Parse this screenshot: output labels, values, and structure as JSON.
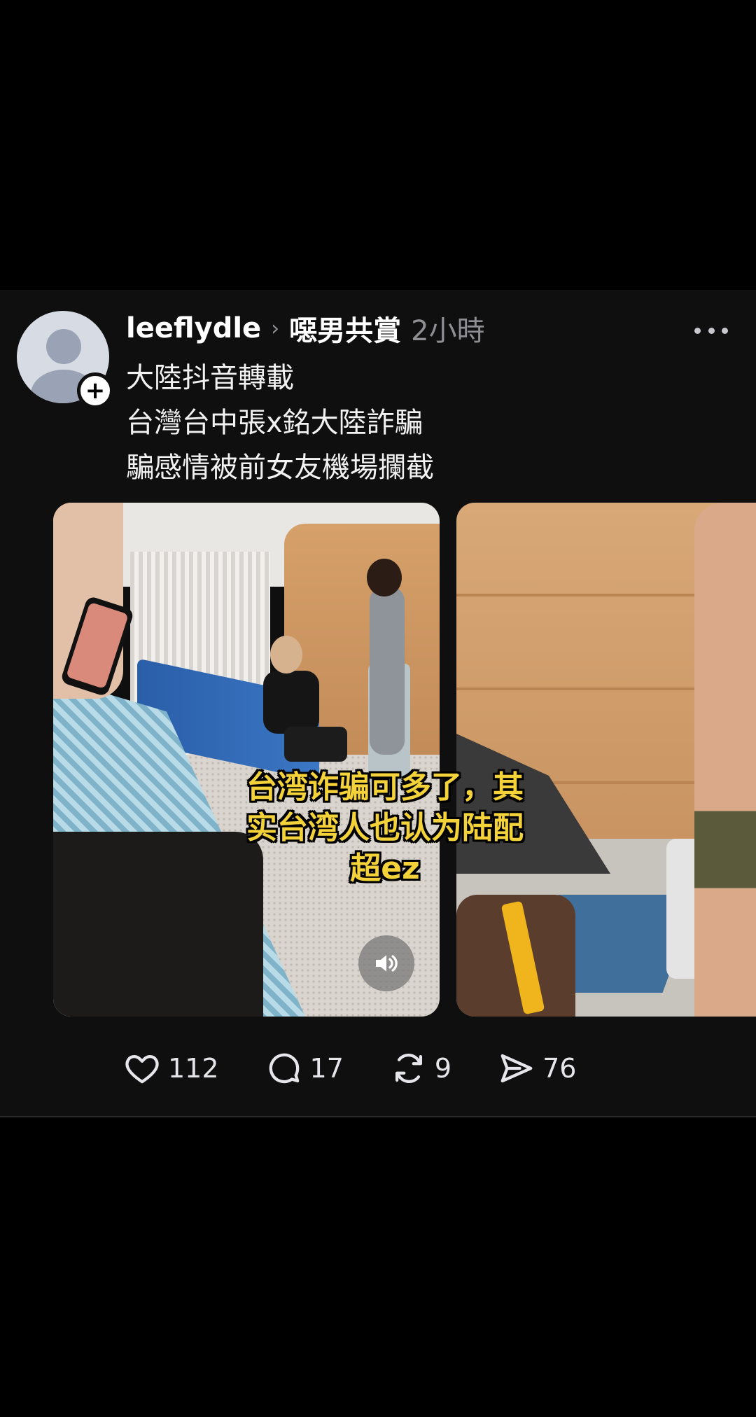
{
  "post": {
    "username": "leeflydle",
    "topic": "噁男共賞",
    "time": "2小時",
    "content_lines": [
      "大陸抖音轉載",
      "台灣台中張x銘大陸詐騙",
      "騙感情被前女友機場攔截"
    ],
    "video_caption": [
      "台湾诈骗可多了，其",
      "实台湾人也认为陆配",
      "超ez"
    ]
  },
  "actions": {
    "like_count": "112",
    "comment_count": "17",
    "repost_count": "9",
    "share_count": "76"
  },
  "icons": {
    "more": "more-icon",
    "follow": "plus-icon",
    "sound": "speaker-icon"
  },
  "colors": {
    "background": "#0f0f10",
    "caption": "#f3d23a",
    "secondary_text": "#8e8e93"
  }
}
